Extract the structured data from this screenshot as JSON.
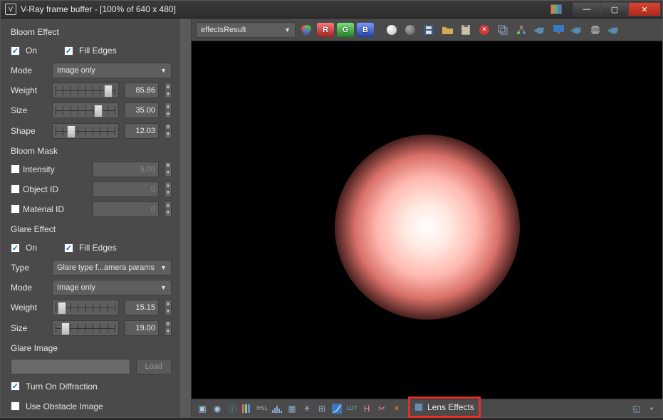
{
  "title": "V-Ray frame buffer - [100% of 640 x 480]",
  "toolbar": {
    "channel": "effectsResult"
  },
  "bloom": {
    "section": "Bloom Effect",
    "on_label": "On",
    "fill_label": "Fill Edges",
    "mode_label": "Mode",
    "mode_value": "Image only",
    "weight_label": "Weight",
    "weight_value": "85.86",
    "size_label": "Size",
    "size_value": "35.00",
    "shape_label": "Shape",
    "shape_value": "12.03"
  },
  "bloom_mask": {
    "section": "Bloom Mask",
    "intensity_label": "Intensity",
    "intensity_value": "5.00",
    "object_label": "Object ID",
    "object_value": "0",
    "material_label": "Material ID",
    "material_value": "0"
  },
  "glare": {
    "section": "Glare Effect",
    "on_label": "On",
    "fill_label": "Fill Edges",
    "type_label": "Type",
    "type_value": "Glare type f...amera params",
    "mode_label": "Mode",
    "mode_value": "Image only",
    "weight_label": "Weight",
    "weight_value": "15.15",
    "size_label": "Size",
    "size_value": "19.00"
  },
  "glare_image": {
    "section": "Glare Image",
    "load_label": "Load",
    "diffraction_label": "Turn On Diffraction",
    "obstacle_label": "Use Obstacle Image"
  },
  "bottom": {
    "lens_label": "Lens Effects"
  }
}
